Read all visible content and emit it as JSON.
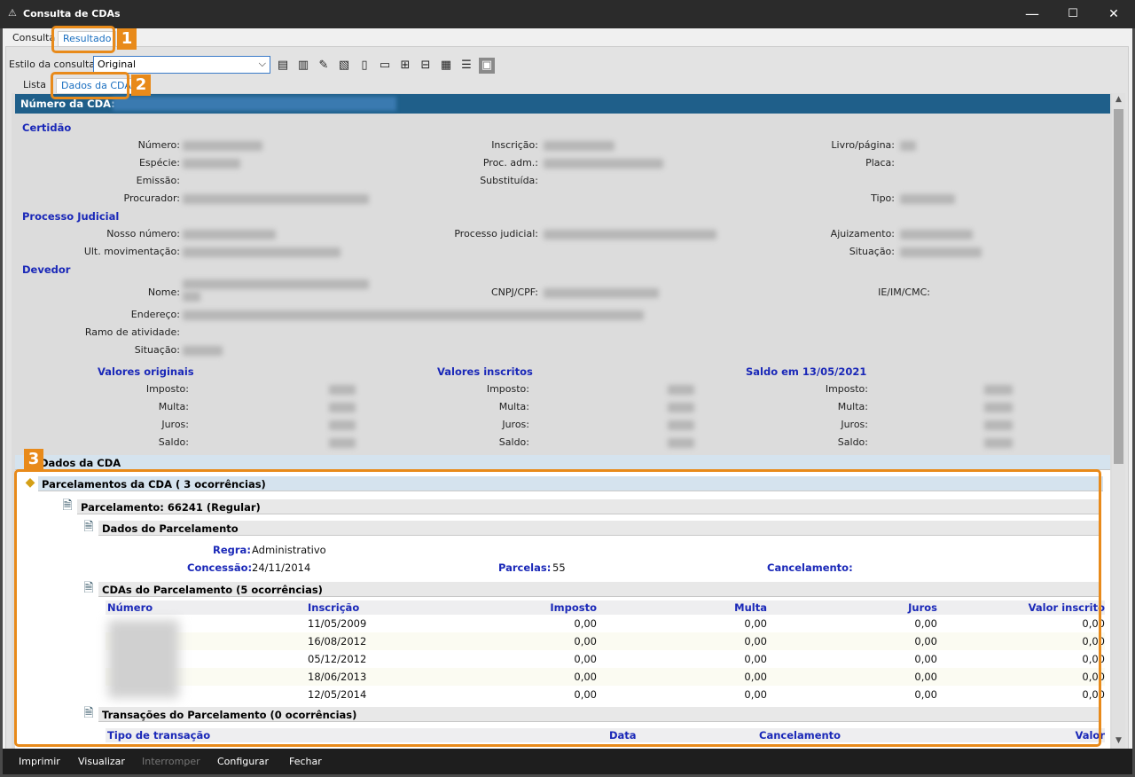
{
  "window": {
    "title": "Consulta de CDAs",
    "minimize": "—",
    "maximize": "☐",
    "close": "✕"
  },
  "tabs_top": [
    "Consulta",
    "Resultado"
  ],
  "style": {
    "label": "Estilo da consulta",
    "value": "Original"
  },
  "tabs_sub": [
    "Lista",
    "Dados da CDA"
  ],
  "badges": [
    "1",
    "2",
    "3"
  ],
  "header": {
    "label": "Número da CDA:"
  },
  "sections": {
    "certidao": "Certidão",
    "processo": "Processo Judicial",
    "devedor": "Devedor"
  },
  "fields": {
    "numero": "Número:",
    "inscricao": "Inscrição:",
    "livro": "Livro/página:",
    "especie": "Espécie:",
    "proc_adm": "Proc. adm.:",
    "placa": "Placa:",
    "emissao": "Emissão:",
    "substituida": "Substituída:",
    "procurador": "Procurador:",
    "tipo": "Tipo:",
    "nosso_numero": "Nosso número:",
    "processo_judicial": "Processo judicial:",
    "ajuizamento": "Ajuizamento:",
    "ult_mov": "Ult. movimentação:",
    "situacao": "Situação:",
    "nome": "Nome:",
    "cnpj": "CNPJ/CPF:",
    "ie": "IE/IM/CMC:",
    "endereco": "Endereço:",
    "ramo": "Ramo de atividade:",
    "situacao2": "Situação:"
  },
  "valores": {
    "originais": "Valores originais",
    "inscritos": "Valores inscritos",
    "saldo": "Saldo em 13/05/2021",
    "labels": [
      "Imposto:",
      "Multa:",
      "Juros:",
      "Saldo:"
    ]
  },
  "tree": {
    "dados_cda": "Dados da CDA",
    "parcelamentos": "Parcelamentos da CDA ( 3 ocorrências)",
    "parcelamento": "Parcelamento: 66241 (Regular)",
    "dados_parc": "Dados do Parcelamento",
    "regra_label": "Regra:",
    "regra": "Administrativo",
    "concessao_label": "Concessão:",
    "concessao": "24/11/2014",
    "parcelas_label": "Parcelas:",
    "parcelas": "55",
    "cancel_label": "Cancelamento:",
    "cdas_parc": "CDAs do Parcelamento (5 ocorrências)",
    "trans_parc": "Transações do Parcelamento (0 ocorrências)"
  },
  "cdas_table": {
    "headers": [
      "Número",
      "Inscrição",
      "Imposto",
      "Multa",
      "Juros",
      "Valor inscrito"
    ],
    "rows": [
      [
        "11/05/2009",
        "0,00",
        "0,00",
        "0,00",
        "0,00"
      ],
      [
        "16/08/2012",
        "0,00",
        "0,00",
        "0,00",
        "0,00"
      ],
      [
        "05/12/2012",
        "0,00",
        "0,00",
        "0,00",
        "0,00"
      ],
      [
        "18/06/2013",
        "0,00",
        "0,00",
        "0,00",
        "0,00"
      ],
      [
        "12/05/2014",
        "0,00",
        "0,00",
        "0,00",
        "0,00"
      ]
    ]
  },
  "trans_table": {
    "headers": [
      "Tipo de transação",
      "Data",
      "Cancelamento",
      "Valor"
    ]
  },
  "bottom": [
    "Imprimir",
    "Visualizar",
    "Interromper",
    "Configurar",
    "Fechar"
  ],
  "colors": {
    "accent": "#e88a1a",
    "header": "#1f5f8a",
    "label_blue": "#1a28b8"
  }
}
